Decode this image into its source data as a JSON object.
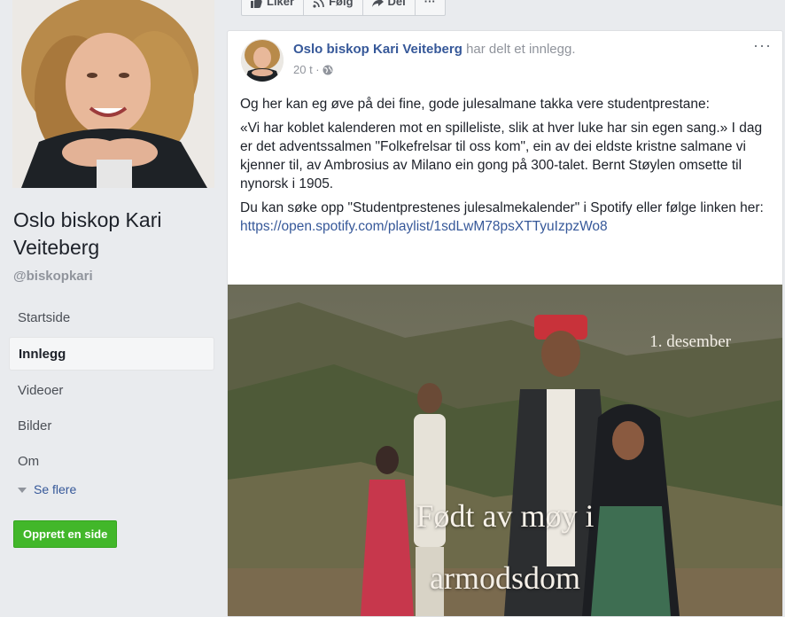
{
  "page": {
    "name": "Oslo biskop Kari Veiteberg",
    "username": "@biskopkari"
  },
  "nav": {
    "items": [
      {
        "label": "Startside"
      },
      {
        "label": "Innlegg",
        "active": true
      },
      {
        "label": "Videoer"
      },
      {
        "label": "Bilder"
      },
      {
        "label": "Om"
      }
    ],
    "see_more": "Se flere",
    "create_page": "Opprett en side"
  },
  "actions": {
    "like": "Liker",
    "follow": "Følg",
    "share": "Del",
    "more": "···"
  },
  "post": {
    "author": "Oslo biskop Kari Veiteberg",
    "action_text": " har delt et innlegg.",
    "time": "20 t ·",
    "more": "···",
    "paragraphs": [
      "Og her kan eg øve på dei fine, gode julesalmane takka vere studentprestane:",
      "«Vi har koblet kalenderen mot en spilleliste, slik at hver luke har sin egen sang.» I dag er det adventssalmen \"Folkefrelsar til oss kom\", ein av dei eldste kristne salmane vi kjenner til, av Ambrosius av Milano ein gong på 300-talet. Bernt Støylen omsette til nynorsk i 1905."
    ],
    "link_intro": "Du kan søke opp \"Studentprestenes julesalmekalender\" i Spotify eller følge linken her: ",
    "link_url": "https://open.spotify.com/playlist/1sdLwM78psXTTyuIzpzWo8",
    "image": {
      "date": "1. desember",
      "title_line1": "Født av møy i",
      "title_line2": "armodsdom"
    }
  },
  "colors": {
    "link": "#365899",
    "green_button": "#42b72a",
    "background": "#e9ebee"
  }
}
